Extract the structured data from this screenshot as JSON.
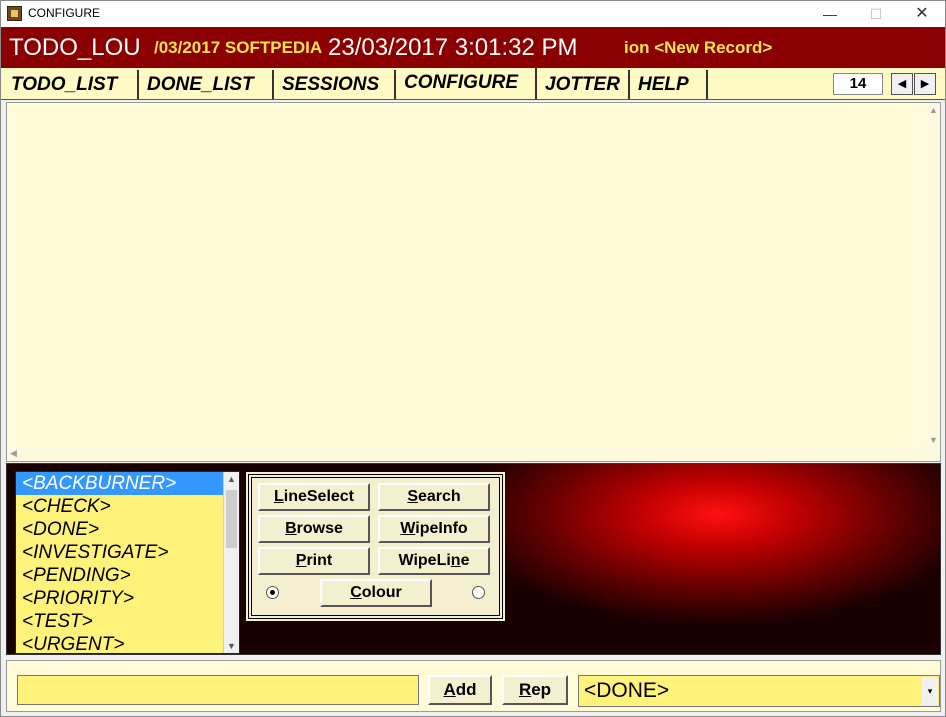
{
  "window": {
    "title": "CONFIGURE",
    "minimize": "—",
    "maximize": "☐",
    "close": "✕"
  },
  "header": {
    "user": "TODO_LOU",
    "mid_text": "/03/2017 SOFTPEDIA",
    "datetime": "23/03/2017   3:01:32 PM",
    "record": "ion <New Record>"
  },
  "tabs": [
    {
      "label": "TODO_LIST"
    },
    {
      "label": "DONE_LIST"
    },
    {
      "label": "SESSIONS"
    },
    {
      "label": "CONFIGURE"
    },
    {
      "label": "JOTTER"
    },
    {
      "label": "HELP"
    }
  ],
  "active_tab": "CONFIGURE",
  "page_count": "14",
  "nav": {
    "prev": "◀",
    "next": "▶"
  },
  "categories": [
    {
      "label": "<BACKBURNER>"
    },
    {
      "label": "<CHECK>"
    },
    {
      "label": "<DONE>"
    },
    {
      "label": "<INVESTIGATE>"
    },
    {
      "label": "<PENDING>"
    },
    {
      "label": "<PRIORITY>"
    },
    {
      "label": "<TEST>"
    },
    {
      "label": "<URGENT>"
    }
  ],
  "selected_category": "<BACKBURNER>",
  "buttons": {
    "lineselect": {
      "key": "L",
      "rest": "ineSelect"
    },
    "search": {
      "key": "S",
      "rest": "earch"
    },
    "browse": {
      "key": "B",
      "rest": "rowse"
    },
    "wipeinfo_pre": "",
    "wipeinfo_key": "W",
    "wipeinfo_rest": "ipeInfo",
    "print": {
      "key": "P",
      "rest": "rint"
    },
    "wipeline_pre": "WipeLi",
    "wipeline_key": "n",
    "wipeline_rest": "e",
    "colour": {
      "key": "C",
      "rest": "olour"
    }
  },
  "footer": {
    "entry_value": "",
    "add": {
      "key": "A",
      "rest": "dd"
    },
    "rep": {
      "key": "R",
      "rest": "ep"
    },
    "combo_value": "<DONE>",
    "combo_arrow": "▾"
  },
  "colors": {
    "header_bg": "#8b0000",
    "header_accent": "#ffe44d",
    "tab_bg": "#fff9c4",
    "list_bg": "#fff27a",
    "selection": "#3399ff"
  }
}
